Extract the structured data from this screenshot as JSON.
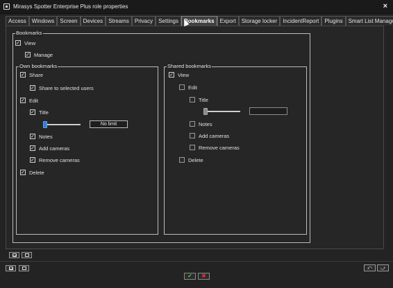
{
  "window": {
    "title": "Mirasys Spotter Enterprise Plus role properties",
    "close_icon": "×"
  },
  "tabs": [
    {
      "label": "Access",
      "active": false
    },
    {
      "label": "Windows",
      "active": false
    },
    {
      "label": "Screen",
      "active": false
    },
    {
      "label": "Devices",
      "active": false
    },
    {
      "label": "Streams",
      "active": false
    },
    {
      "label": "Privacy",
      "active": false
    },
    {
      "label": "Settings",
      "active": false
    },
    {
      "label": "Bookmarks",
      "active": true
    },
    {
      "label": "Export",
      "active": false
    },
    {
      "label": "Storage locker",
      "active": false
    },
    {
      "label": "IncidentReport",
      "active": false
    },
    {
      "label": "Plugins",
      "active": false
    },
    {
      "label": "Smart List Management",
      "active": false
    }
  ],
  "bookmarks": {
    "legend": "Bookmarks",
    "view": {
      "label": "View",
      "checked": true
    },
    "manage": {
      "label": "Manage",
      "checked": true
    }
  },
  "own": {
    "legend": "Own bookmarks",
    "share": {
      "label": "Share",
      "checked": true
    },
    "share_selected": {
      "label": "Share to selected users",
      "checked": true
    },
    "edit": {
      "label": "Edit",
      "checked": true
    },
    "title": {
      "label": "Title",
      "checked": true
    },
    "slider_value": 0,
    "limit_text": "No limit",
    "notes": {
      "label": "Notes",
      "checked": true
    },
    "add_cameras": {
      "label": "Add cameras",
      "checked": true
    },
    "remove_cameras": {
      "label": "Remove cameras",
      "checked": true
    },
    "delete": {
      "label": "Delete",
      "checked": true
    }
  },
  "shared": {
    "legend": "Shared bookmarks",
    "view": {
      "label": "View",
      "checked": true
    },
    "edit": {
      "label": "Edit",
      "checked": false
    },
    "title": {
      "label": "Title",
      "checked": false
    },
    "slider_value": 0,
    "limit_text": "",
    "notes": {
      "label": "Notes",
      "checked": false
    },
    "add_cameras": {
      "label": "Add cameras",
      "checked": false
    },
    "remove_cameras": {
      "label": "Remove cameras",
      "checked": false
    },
    "delete": {
      "label": "Delete",
      "checked": false
    }
  },
  "footer": {
    "ok_symbol": "✔",
    "cancel_symbol": "✖"
  },
  "colors": {
    "background": "#232323",
    "slider_active": "#2f7fd8",
    "ok": "#4cc04c",
    "cancel": "#e03535"
  }
}
